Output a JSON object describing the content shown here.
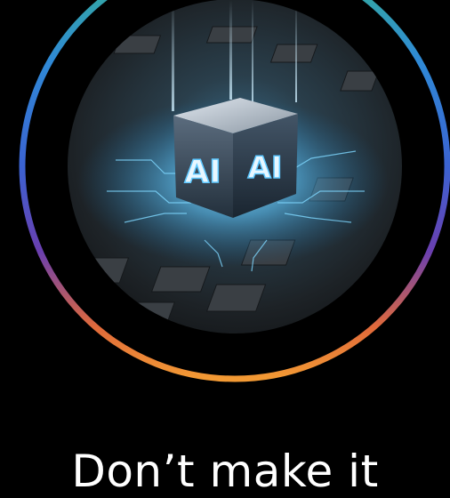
{
  "hero": {
    "image_label": "AI",
    "ring_colors": [
      "#35b58c",
      "#2f8ad6",
      "#3b63d2",
      "#6a3fb0",
      "#e16a3a",
      "#f39a34"
    ],
    "glow_color": "#5ec8ff"
  },
  "caption": {
    "text": "Don’t make it"
  }
}
